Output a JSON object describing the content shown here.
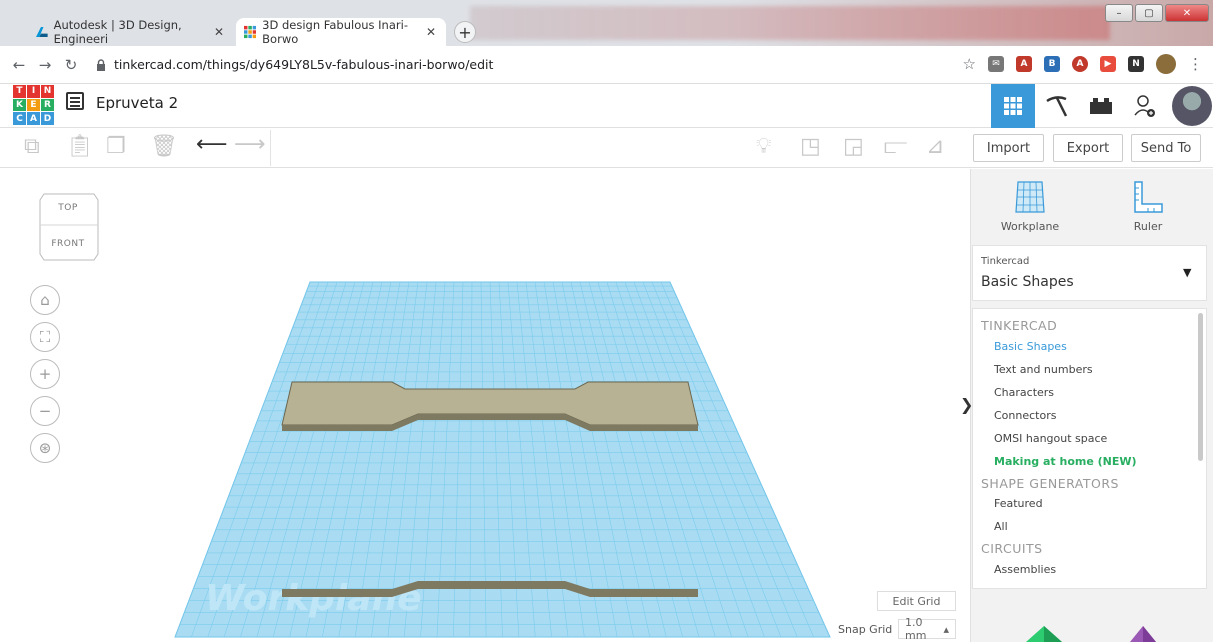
{
  "browser": {
    "tabs": [
      {
        "title": "Autodesk | 3D Design, Engineeri",
        "active": false
      },
      {
        "title": "3D design Fabulous Inari-Borwo",
        "active": true
      }
    ],
    "new_tab": "+",
    "url": "tinkercad.com/things/dy649LY8L5v-fabulous-inari-borwo/edit",
    "window_buttons": {
      "minimize": "–",
      "maximize": "▢",
      "close": "✕"
    }
  },
  "app": {
    "logo_letters": [
      "T",
      "I",
      "N",
      "K",
      "E",
      "R",
      "C",
      "A",
      "D"
    ],
    "design_title": "Epruveta 2",
    "accent": "#3a9ad9"
  },
  "toolbar": {
    "import": "Import",
    "export": "Export",
    "send_to": "Send To"
  },
  "viewcube": {
    "top": "TOP",
    "front": "FRONT"
  },
  "viewport": {
    "workplane_label": "Workplane",
    "edit_grid": "Edit Grid",
    "snap_grid_label": "Snap Grid",
    "snap_grid_value": "1.0 mm"
  },
  "panel": {
    "workplane": "Workplane",
    "ruler": "Ruler",
    "library_source": "Tinkercad",
    "library_selected": "Basic Shapes",
    "collapse": "❯"
  },
  "library_list": {
    "sections": [
      {
        "header": "TINKERCAD",
        "items": [
          {
            "label": "Basic Shapes",
            "state": "selected"
          },
          {
            "label": "Text and numbers",
            "state": ""
          },
          {
            "label": "Characters",
            "state": ""
          },
          {
            "label": "Connectors",
            "state": ""
          },
          {
            "label": "OMSI hangout space",
            "state": ""
          },
          {
            "label": "Making at home (NEW)",
            "state": "new"
          }
        ]
      },
      {
        "header": "SHAPE GENERATORS",
        "items": [
          {
            "label": "Featured",
            "state": ""
          },
          {
            "label": "All",
            "state": ""
          }
        ]
      },
      {
        "header": "CIRCUITS",
        "items": [
          {
            "label": "Assemblies",
            "state": ""
          }
        ]
      }
    ]
  }
}
